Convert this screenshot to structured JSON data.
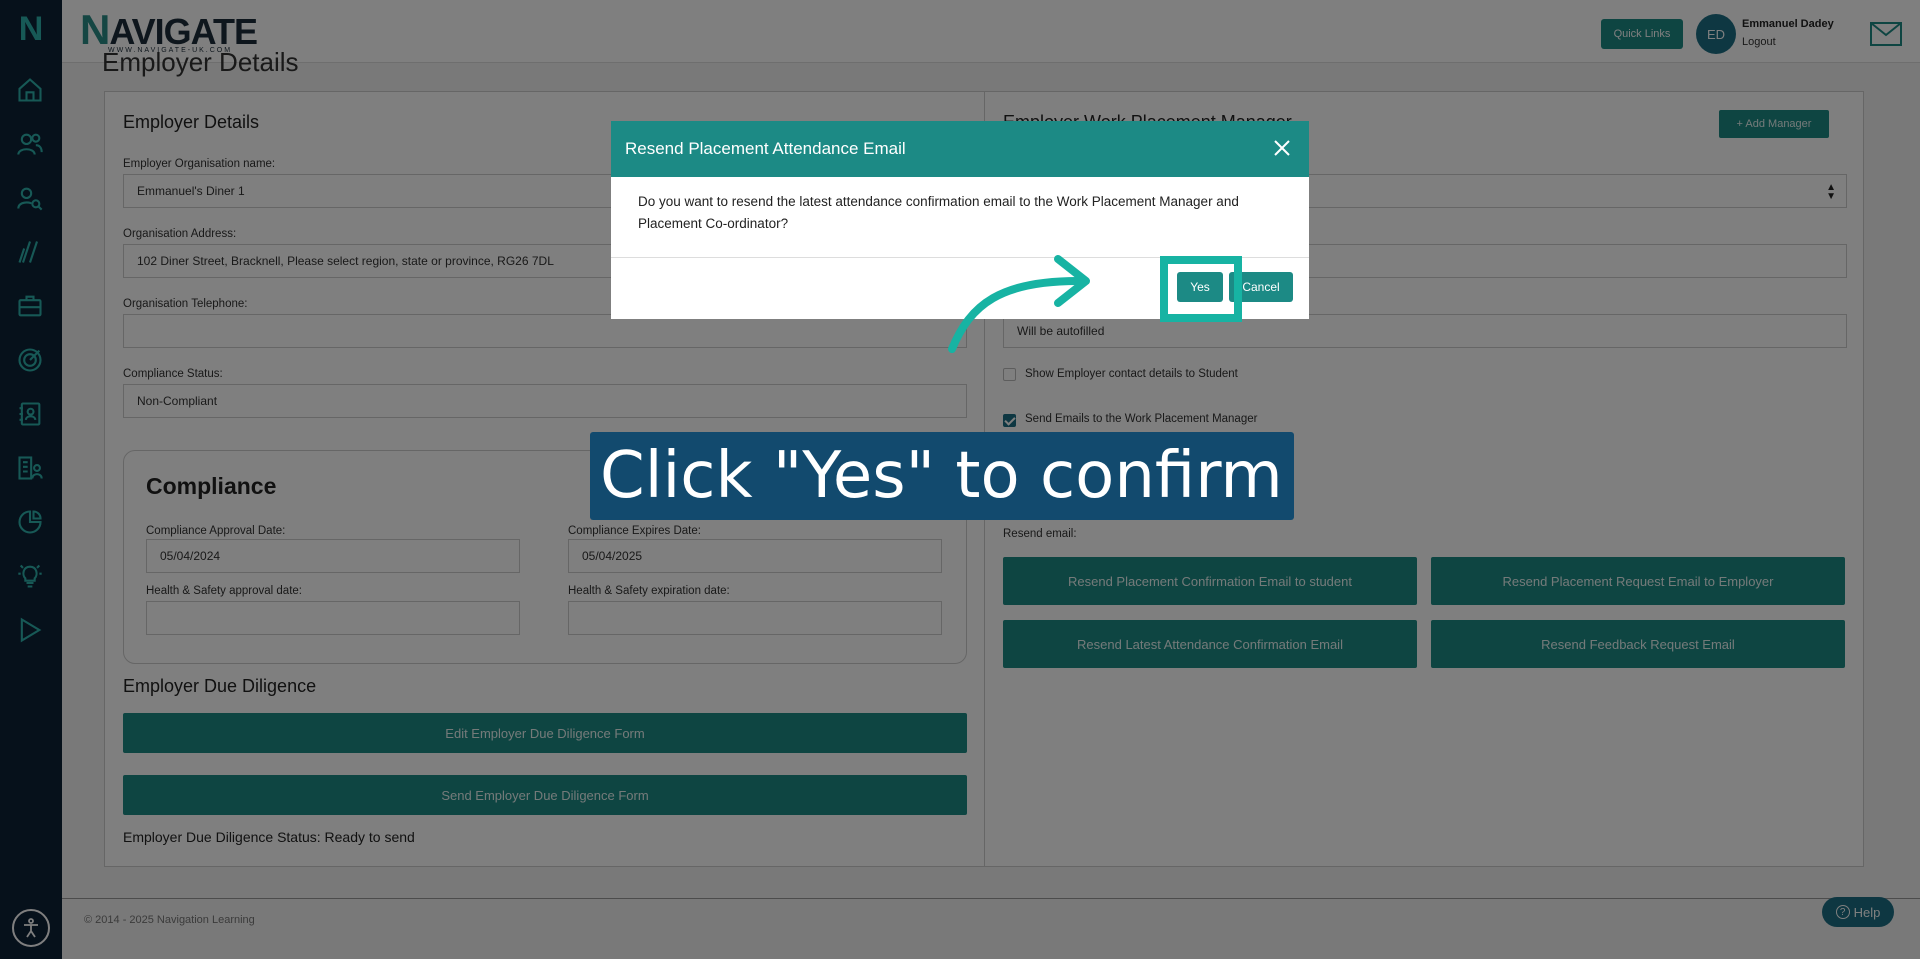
{
  "sidebar": {
    "logo": "N",
    "icons": [
      "home-icon",
      "users-icon",
      "user-search-icon",
      "slash-lines-icon",
      "briefcase-icon",
      "target-icon",
      "contact-book-icon",
      "building-people-icon",
      "chart-pie-icon",
      "lightbulb-icon",
      "play-icon"
    ]
  },
  "header": {
    "brand_name_n": "N",
    "brand_name_rest": "AVIGATE",
    "brand_url": "WWW.NAVIGATE-UK.COM",
    "quick_links": "Quick Links",
    "avatar_initials": "ED",
    "user_name": "Emmanuel Dadey",
    "logout": "Logout"
  },
  "page": {
    "title": "Employer Details"
  },
  "employer": {
    "heading": "Employer Details",
    "org_name_label": "Employer Organisation name:",
    "org_name_value": "Emmanuel's Diner 1",
    "address_label": "Organisation Address:",
    "address_value": "102 Diner Street, Bracknell, Please select region, state or province, RG26 7DL",
    "telephone_label": "Organisation Telephone:",
    "telephone_value": "",
    "compliance_status_label": "Compliance Status:",
    "compliance_status_value": "Non-Compliant"
  },
  "compliance": {
    "heading": "Compliance",
    "approval_date_label": "Compliance Approval Date:",
    "approval_date_value": "05/04/2024",
    "expires_date_label": "Compliance Expires Date:",
    "expires_date_value": "05/04/2025",
    "hs_approval_label": "Health & Safety approval date:",
    "hs_approval_value": "",
    "hs_expiration_label": "Health & Safety expiration date:",
    "hs_expiration_value": ""
  },
  "due_diligence": {
    "heading": "Employer Due Diligence",
    "edit_button": "Edit Employer Due Diligence Form",
    "send_button": "Send Employer Due Diligence Form",
    "status": "Employer Due Diligence Status: Ready to send"
  },
  "manager": {
    "heading": "Employer Work Placement Manager",
    "add_manager": "+ Add Manager",
    "autofilled_value": "Will be autofilled",
    "show_contact_label": "Show Employer contact details to Student",
    "send_emails_label": "Send Emails to the Work Placement Manager",
    "resend_label": "Resend email:",
    "buttons": {
      "confirm_student": "Resend Placement Confirmation Email to student",
      "request_employer": "Resend Placement Request Email to Employer",
      "attendance": "Resend Latest Attendance Confirmation Email",
      "feedback": "Resend Feedback Request Email"
    }
  },
  "footer": {
    "copyright": "© 2014 - 2025 Navigation Learning",
    "help": "Help"
  },
  "modal": {
    "title": "Resend Placement Attendance Email",
    "body": "Do you want to resend the latest attendance confirmation email to the Work Placement Manager and Placement Co-ordinator?",
    "yes": "Yes",
    "cancel": "Cancel"
  },
  "annotation": {
    "callout": "Click \"Yes\" to confirm"
  },
  "colors": {
    "teal": "#1c8a85",
    "sidebar": "#0d2236",
    "callout_bg": "#124a6e",
    "highlight": "#17b3a3"
  }
}
